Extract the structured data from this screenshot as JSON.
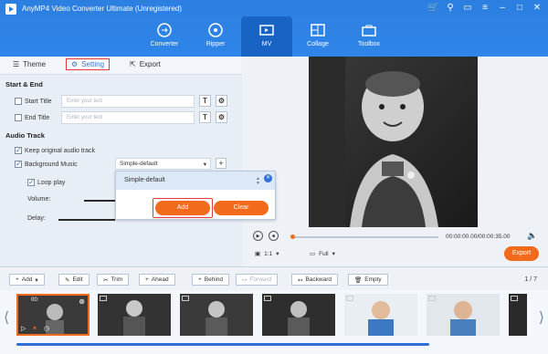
{
  "app": {
    "title": "AnyMP4 Video Converter Ultimate (Unregistered)"
  },
  "nav": {
    "tabs": [
      "Converter",
      "Ripper",
      "MV",
      "Collage",
      "Toolbox"
    ],
    "active": "MV"
  },
  "subtabs": {
    "theme": "Theme",
    "setting": "Setting",
    "export": "Export"
  },
  "start_end": {
    "heading": "Start & End",
    "start_title": {
      "label": "Start Title",
      "placeholder": "Enter your text"
    },
    "end_title": {
      "label": "End Title",
      "placeholder": "Enter your text"
    },
    "text_button": "T"
  },
  "audio": {
    "heading": "Audio Track",
    "keep_original": "Keep original audio track",
    "background_music": "Background Music",
    "music_value": "Simple-default",
    "loop_play": "Loop play",
    "volume_label": "Volume:",
    "delay_label": "Delay:"
  },
  "popup": {
    "item": "Simple-default",
    "add": "Add",
    "clear": "Clear"
  },
  "player": {
    "time": "00:00:00.00/00:00:35.00",
    "ratio": "1:1",
    "size": "Full",
    "export": "Export"
  },
  "toolbar": {
    "add": "Add",
    "edit": "Edit",
    "trim": "Trim",
    "ahead": "Ahead",
    "behind": "Behind",
    "forward": "Forward",
    "backward": "Backward",
    "empty": "Empty",
    "page": "1 / 7",
    "thumb_time": "00:"
  },
  "colors": {
    "accent": "#2c7fe0",
    "orange": "#f26b1d",
    "highlight": "#e03a3a"
  }
}
